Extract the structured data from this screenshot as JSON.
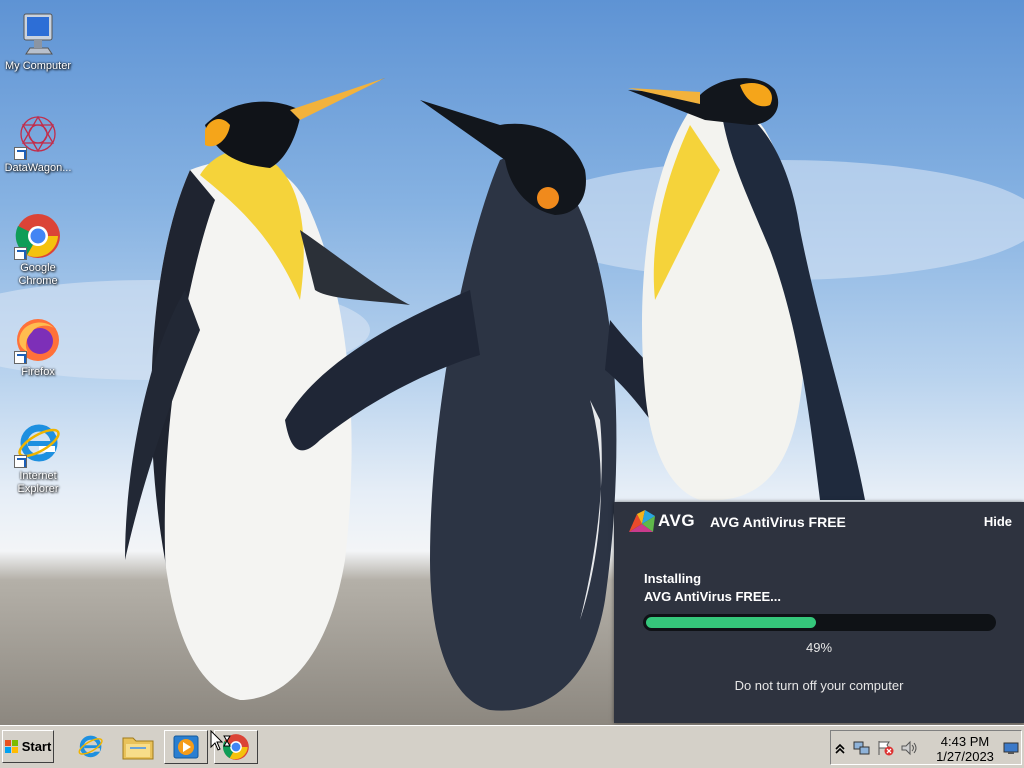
{
  "desktop": {
    "icons": [
      {
        "label": "My Computer",
        "icon": "my-computer-icon"
      },
      {
        "label": "DataWagon...",
        "icon": "datawagon-icon"
      },
      {
        "label": "Google Chrome",
        "icon": "chrome-icon"
      },
      {
        "label": "Firefox",
        "icon": "firefox-icon"
      },
      {
        "label": "Internet Explorer",
        "icon": "internet-explorer-icon"
      }
    ]
  },
  "avg_popup": {
    "logo_text": "AVG",
    "title": "AVG AntiVirus FREE",
    "hide_label": "Hide",
    "status_line1": "Installing",
    "status_line2": "AVG AntiVirus FREE...",
    "progress_percent": 49,
    "progress_label": "49%",
    "warning": "Do not turn off your computer",
    "colors": {
      "background": "#2e333f",
      "progress": "#35c77b",
      "track": "#0f1216"
    }
  },
  "taskbar": {
    "start_label": "Start",
    "quick_launch": [
      {
        "name": "internet-explorer-icon"
      },
      {
        "name": "folder-icon"
      },
      {
        "name": "media-player-icon"
      },
      {
        "name": "chrome-icon"
      }
    ],
    "tray": {
      "icons": [
        "show-hidden-icon",
        "network-icon",
        "action-center-icon",
        "volume-icon",
        "desktop-icon"
      ],
      "time": "4:43 PM",
      "date": "1/27/2023"
    }
  }
}
